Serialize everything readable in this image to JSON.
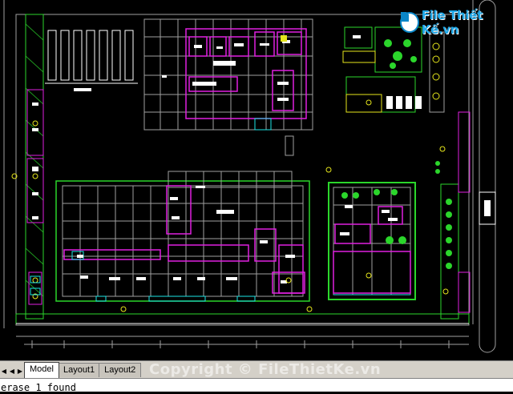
{
  "logo": {
    "text": "File Thiết Kế.vn",
    "badge_icon": "file-icon"
  },
  "tabs": [
    {
      "label": "Model",
      "active": true
    },
    {
      "label": "Layout1",
      "active": false
    },
    {
      "label": "Layout2",
      "active": false
    }
  ],
  "watermark": "Copyright © FileThietKe.vn",
  "command_line": {
    "text": "erase 1 found"
  },
  "colors": {
    "background": "#000000",
    "green": "#2bd62b",
    "magenta": "#e020e0",
    "white": "#ffffff",
    "yellow": "#e6e61c",
    "cyan": "#1ce6e6",
    "grey": "#a0a0a0",
    "accent": "#20a8e8"
  }
}
